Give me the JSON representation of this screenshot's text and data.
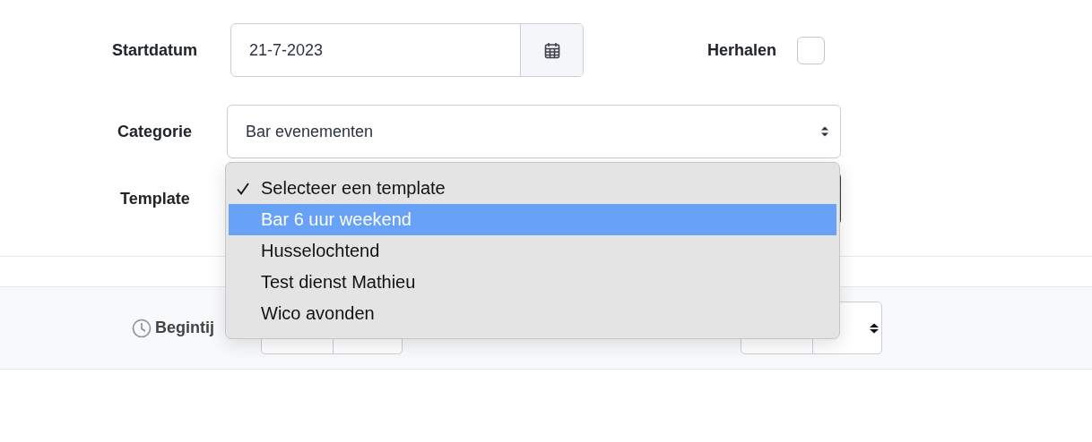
{
  "start_date": {
    "label": "Startdatum",
    "value": "21-7-2023"
  },
  "repeat": {
    "label": "Herhalen",
    "checked": false
  },
  "category": {
    "label": "Categorie",
    "value": "Bar evenementen"
  },
  "template": {
    "label": "Template"
  },
  "template_menu": [
    {
      "label": "Selecteer een template",
      "selected": true,
      "highlighted": false
    },
    {
      "label": "Bar 6 uur weekend",
      "selected": false,
      "highlighted": true
    },
    {
      "label": "Husselochtend",
      "selected": false,
      "highlighted": false
    },
    {
      "label": "Test dienst Mathieu",
      "selected": false,
      "highlighted": false
    },
    {
      "label": "Wico avonden",
      "selected": false,
      "highlighted": false
    }
  ],
  "time_section": {
    "label": "Begintij"
  }
}
